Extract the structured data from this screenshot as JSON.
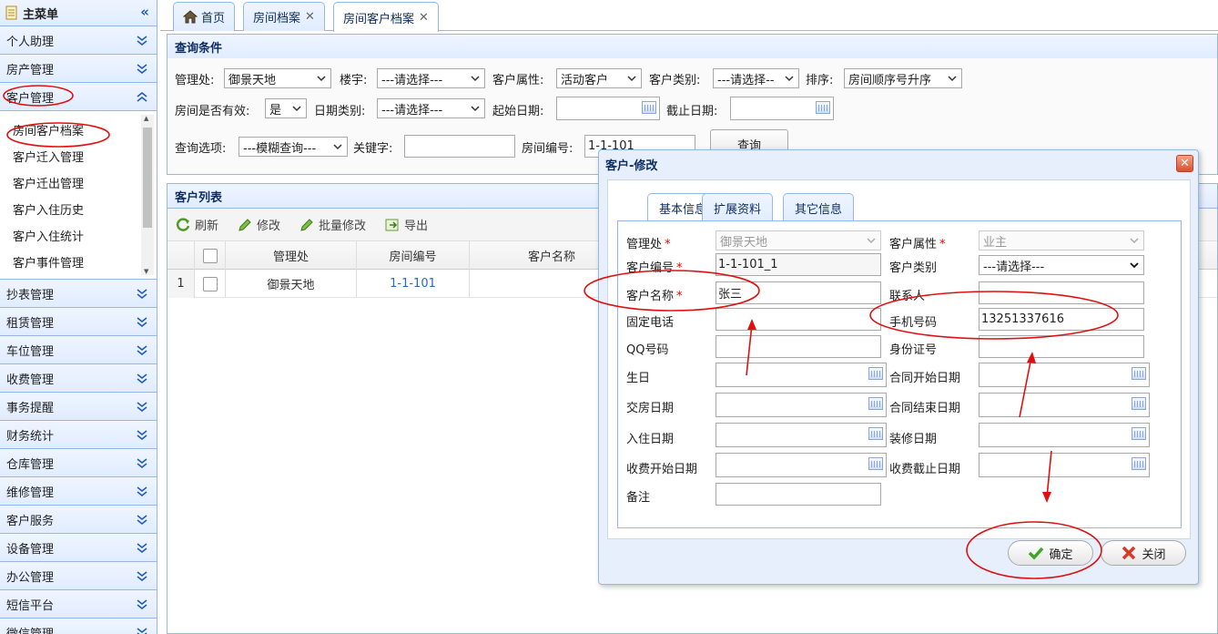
{
  "sidebar": {
    "title": "主菜单",
    "menus": [
      "个人助理",
      "房产管理",
      "客户管理",
      "抄表管理",
      "租赁管理",
      "车位管理",
      "收费管理",
      "事务提醒",
      "财务统计",
      "仓库管理",
      "维修管理",
      "客户服务",
      "设备管理",
      "办公管理",
      "短信平台",
      "微信管理"
    ],
    "sub_items": [
      "房间客户档案",
      "客户迁入管理",
      "客户迁出管理",
      "客户入住历史",
      "客户入住统计",
      "客户事件管理"
    ]
  },
  "tabs": [
    "首页",
    "房间档案",
    "房间客户档案"
  ],
  "query": {
    "title": "查询条件",
    "label_mgmt": "管理处:",
    "mgmt": "御景天地",
    "label_building": "楼宇:",
    "building": "---请选择---",
    "label_attr": "客户属性:",
    "attr": "活动客户",
    "label_type": "客户类别:",
    "type": "---请选择--",
    "label_sort": "排序:",
    "sort": "房间顺序号升序",
    "label_valid": "房间是否有效:",
    "valid": "是",
    "label_datetype": "日期类别:",
    "datetype": "---请选择---",
    "label_start": "起始日期:",
    "label_end": "截止日期:",
    "label_option": "查询选项:",
    "option": "---模糊查询---",
    "label_keyword": "关键字:",
    "label_room": "房间编号:",
    "room": "1-1-101",
    "button": "查询"
  },
  "list": {
    "title": "客户列表",
    "toolbar": [
      "刷新",
      "修改",
      "批量修改",
      "导出"
    ],
    "columns": [
      "管理处",
      "房间编号",
      "客户名称"
    ],
    "rows": [
      {
        "idx": "1",
        "mgmt": "御景天地",
        "room": "1-1-101",
        "name": ""
      }
    ]
  },
  "dialog": {
    "title": "客户-修改",
    "tabs": [
      "基本信息",
      "扩展资料",
      "其它信息"
    ],
    "fields": {
      "mgmt_label": "管理处",
      "mgmt": "御景天地",
      "attr_label": "客户属性",
      "attr": "业主",
      "code_label": "客户编号",
      "code": "1-1-101_1",
      "type_label": "客户类别",
      "type": "---请选择---",
      "name_label": "客户名称",
      "name": "张三",
      "contact_label": "联系人",
      "contact": "",
      "phone_label": "固定电话",
      "phone": "",
      "mobile_label": "手机号码",
      "mobile": "13251337616",
      "qq_label": "QQ号码",
      "qq": "",
      "id_label": "身份证号",
      "id": "",
      "birthday_label": "生日",
      "contract_start_label": "合同开始日期",
      "handover_label": "交房日期",
      "contract_end_label": "合同结束日期",
      "checkin_label": "入住日期",
      "decor_label": "装修日期",
      "fee_start_label": "收费开始日期",
      "fee_end_label": "收费截止日期",
      "remark_label": "备注"
    },
    "ok": "确定",
    "close": "关闭"
  },
  "colors": {
    "accent": "#95b8e7",
    "annotation": "#e01010"
  }
}
